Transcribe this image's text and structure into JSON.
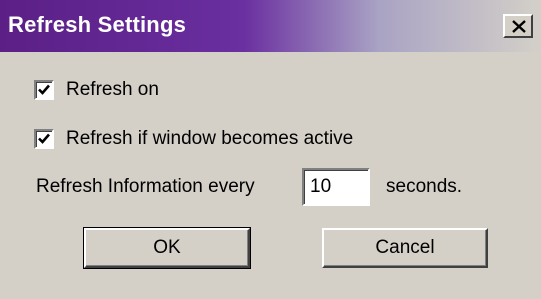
{
  "window": {
    "title": "Refresh Settings",
    "close_icon": "close-icon"
  },
  "options": {
    "refresh_on": {
      "label": "Refresh on",
      "checked": true
    },
    "refresh_if_active": {
      "label": "Refresh if window becomes active",
      "checked": true
    }
  },
  "interval": {
    "label": "Refresh Information every",
    "value": "10",
    "unit": "seconds."
  },
  "buttons": {
    "ok": "OK",
    "cancel": "Cancel"
  },
  "colors": {
    "title_gradient_start": "#5b1f86",
    "title_gradient_end": "#d4d0c8",
    "dialog_bg": "#d4d0c8"
  }
}
